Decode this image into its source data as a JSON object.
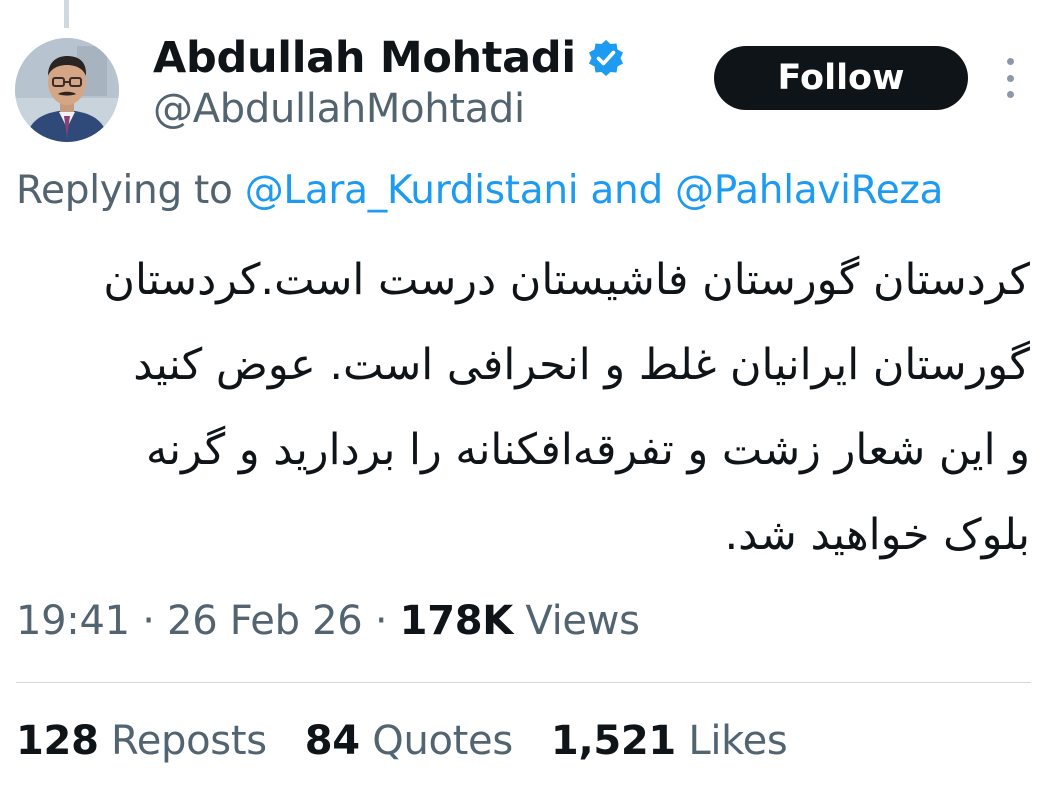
{
  "colors": {
    "accent": "#1d9bf0",
    "text_primary": "#0f1419",
    "text_secondary": "#536471",
    "divider": "#cfd9de",
    "follow_bg": "#0f1419"
  },
  "author": {
    "display_name": "Abdullah Mohtadi",
    "handle": "@AbdullahMohtadi",
    "verified_icon": "verified-badge-icon",
    "avatar_icon": "profile-photo"
  },
  "actions": {
    "follow_label": "Follow",
    "more_icon": "more-vertical-icon"
  },
  "reply": {
    "prefix": "Replying to",
    "mention_1": "@Lara_Kurdistani",
    "connector": "and",
    "mention_2": "@PahlaviReza"
  },
  "tweet": {
    "lines": [
      "کردستان گورستان فاشیستان درست است.کردستان",
      "گورستان ایرانیان  غلط و انحرافی است. عوض کنید",
      "و این شعار زشت و تفرقه‌افکنانه را بردارید و گرنه",
      "بلوک خواهید شد."
    ]
  },
  "meta": {
    "time": "19:41",
    "separator": "·",
    "date": "26 Feb 26",
    "views_count": "178K",
    "views_label": "Views"
  },
  "stats": {
    "reposts_count": "128",
    "reposts_label": "Reposts",
    "quotes_count": "84",
    "quotes_label": "Quotes",
    "likes_count": "1,521",
    "likes_label": "Likes"
  }
}
